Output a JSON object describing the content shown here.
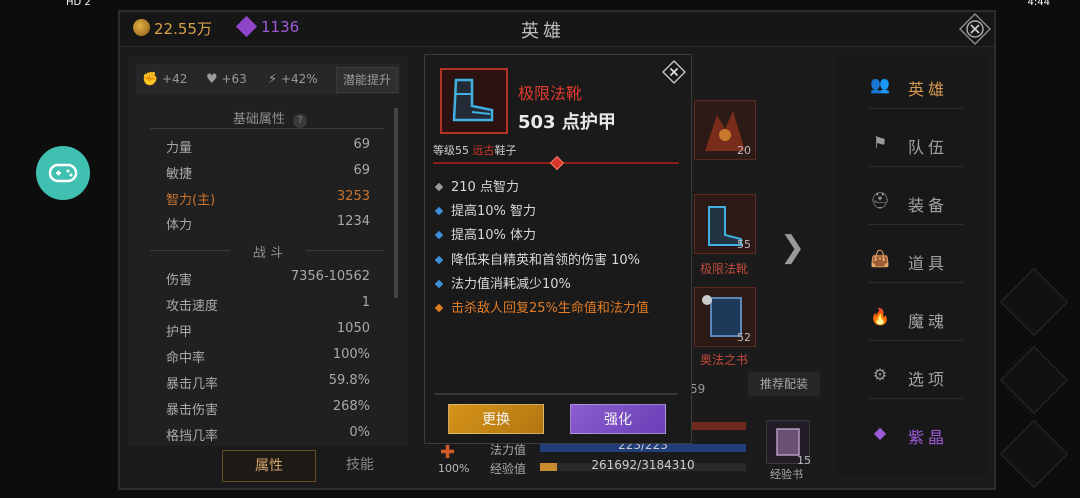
{
  "status_bar": {
    "left": "HD 2",
    "right": "4:44"
  },
  "currency": {
    "gold": "22.55万",
    "gems": "1136"
  },
  "screen_title": "英雄",
  "left_panel": {
    "buffs": [
      "+42",
      "+63",
      "+42%"
    ],
    "potential_button": "潜能提升",
    "basic_header": "基础属性",
    "help_mark": "?",
    "basic_stats": [
      {
        "label": "力量",
        "value": "69"
      },
      {
        "label": "敏捷",
        "value": "69"
      },
      {
        "label": "智力(主)",
        "value": "3253"
      },
      {
        "label": "体力",
        "value": "1234"
      }
    ],
    "combat_header": "战 斗",
    "combat_stats": [
      {
        "label": "伤害",
        "value": "7356-10562"
      },
      {
        "label": "攻击速度",
        "value": "1"
      },
      {
        "label": "护甲",
        "value": "1050"
      },
      {
        "label": "命中率",
        "value": "100%"
      },
      {
        "label": "暴击几率",
        "value": "59.8%"
      },
      {
        "label": "暴击伤害",
        "value": "268%"
      },
      {
        "label": "格挡几率",
        "value": "0%"
      }
    ],
    "tabs": [
      "属性",
      "技能"
    ]
  },
  "middle": {
    "slot_top_count": "20",
    "slot_boots_count": "55",
    "slot_boots_label": "极限法靴",
    "slot_book_count": "52",
    "slot_book_label": "奥法之书",
    "partial_number": "59",
    "recommend_button": "推荐配装",
    "percent": "100%",
    "mana_label": "法力值",
    "mana_value": "223/223",
    "exp_label": "经验值",
    "exp_value": "261692/3184310",
    "exp_fraction": 0.082,
    "expbook_count": "15",
    "expbook_label": "经验书"
  },
  "nav": [
    {
      "label": "英雄",
      "active": true
    },
    {
      "label": "队伍",
      "active": false
    },
    {
      "label": "装备",
      "active": false
    },
    {
      "label": "道具",
      "active": false
    },
    {
      "label": "魔魂",
      "active": false
    },
    {
      "label": "选项",
      "active": false
    },
    {
      "label": "紫晶",
      "active": false
    }
  ],
  "popup": {
    "item_name": "极限法靴",
    "armor": "503 点护甲",
    "level_text": "等级55",
    "rarity": "远古",
    "item_type": "鞋子",
    "attributes": [
      {
        "text": "210 点智力",
        "kind": "gray"
      },
      {
        "text": "提高10% 智力",
        "kind": "blue"
      },
      {
        "text": "提高10% 体力",
        "kind": "blue"
      },
      {
        "text": "降低来自精英和首领的伤害 10%",
        "kind": "blue"
      },
      {
        "text": "法力值消耗减少10%",
        "kind": "blue"
      },
      {
        "text": "击杀敌人回复25%生命值和法力值",
        "kind": "orange"
      }
    ],
    "swap_button": "更换",
    "upgrade_button": "强化"
  }
}
